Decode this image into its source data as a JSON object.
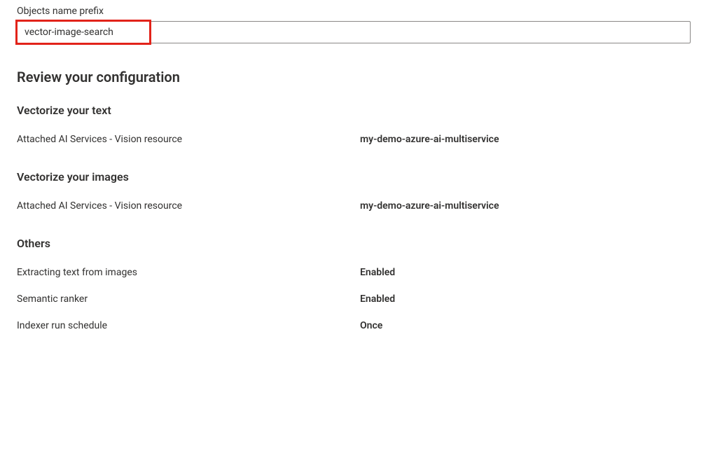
{
  "prefix": {
    "label": "Objects name prefix",
    "value": "vector-image-search"
  },
  "review": {
    "heading": "Review your configuration",
    "sections": {
      "vectorizeText": {
        "heading": "Vectorize your text",
        "rows": [
          {
            "label": "Attached AI Services - Vision resource",
            "value": "my-demo-azure-ai-multiservice"
          }
        ]
      },
      "vectorizeImages": {
        "heading": "Vectorize your images",
        "rows": [
          {
            "label": "Attached AI Services - Vision resource",
            "value": "my-demo-azure-ai-multiservice"
          }
        ]
      },
      "others": {
        "heading": "Others",
        "rows": [
          {
            "label": "Extracting text from images",
            "value": "Enabled"
          },
          {
            "label": "Semantic ranker",
            "value": "Enabled"
          },
          {
            "label": "Indexer run schedule",
            "value": "Once"
          }
        ]
      }
    }
  }
}
